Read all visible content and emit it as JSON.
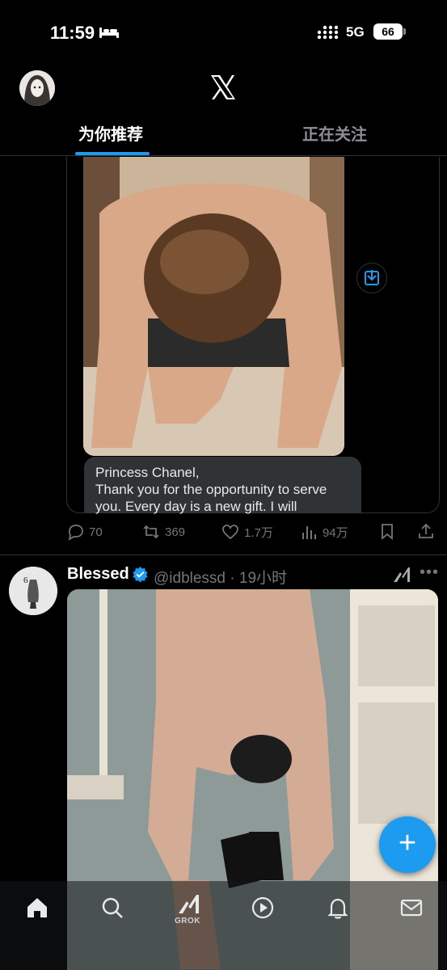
{
  "status_bar": {
    "time": "11:59",
    "network": "5G",
    "battery": "66"
  },
  "header": {
    "logo_icon": "x-logo-icon",
    "tabs": [
      {
        "label": "为你推荐",
        "active": true
      },
      {
        "label": "正在关注",
        "active": false
      }
    ],
    "accent": "#1d9bf0"
  },
  "post1": {
    "dm_text": "Princess Chanel,\nThank you for the opportunity to serve you. Every day is a new gift. I will",
    "actions": {
      "replies": "70",
      "reposts": "369",
      "likes": "1.7万",
      "views": "94万"
    }
  },
  "post2": {
    "author": "Blessed",
    "handle_time": "@idblessd · 19小时",
    "avatar_text": "6"
  },
  "bottom_nav": {
    "grok_label": "GROK",
    "items": [
      "home-icon",
      "search-icon",
      "grok-icon",
      "video-icon",
      "notifications-icon",
      "messages-icon"
    ]
  },
  "fab_label": "+"
}
